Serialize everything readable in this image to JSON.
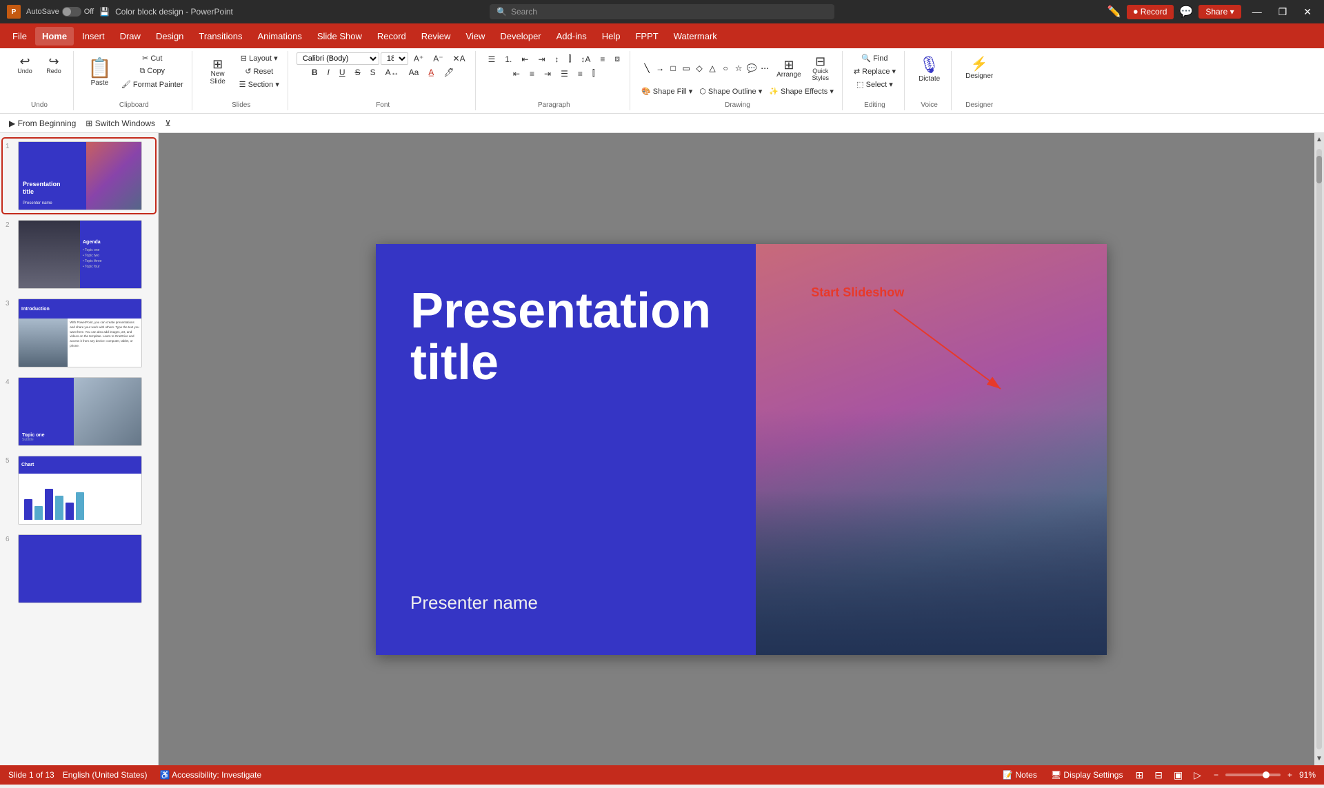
{
  "titleBar": {
    "appName": "PowerPoint",
    "fileName": "Color block design - PowerPoint",
    "autoSave": "AutoSave",
    "autoSaveState": "Off",
    "recordLabel": "Record",
    "shareLabel": "Share",
    "searchPlaceholder": "Search",
    "windowControls": [
      "—",
      "❐",
      "✕"
    ]
  },
  "menuBar": {
    "items": [
      "File",
      "Home",
      "Insert",
      "Draw",
      "Design",
      "Transitions",
      "Animations",
      "Slide Show",
      "Record",
      "Review",
      "View",
      "Developer",
      "Add-ins",
      "Help",
      "FPPT",
      "Watermark"
    ],
    "activeItem": "Home"
  },
  "ribbon": {
    "groups": [
      {
        "name": "undo-group",
        "label": "Undo",
        "buttons": [
          "↩ Undo",
          "↪ Redo"
        ]
      },
      {
        "name": "clipboard-group",
        "label": "Clipboard",
        "buttons": [
          "Paste",
          "Cut",
          "Copy",
          "Format Painter"
        ]
      },
      {
        "name": "slides-group",
        "label": "Slides",
        "buttons": [
          "New Slide",
          "Layout",
          "Reset",
          "Section"
        ]
      },
      {
        "name": "font-group",
        "label": "Font",
        "buttons": [
          "Bold",
          "Italic",
          "Underline",
          "Strikethrough",
          "Shadow"
        ]
      },
      {
        "name": "paragraph-group",
        "label": "Paragraph",
        "buttons": [
          "Bullets",
          "Numbering",
          "Increase Indent",
          "Decrease Indent",
          "Align Left",
          "Center",
          "Align Right",
          "Justify"
        ]
      },
      {
        "name": "drawing-group",
        "label": "Drawing",
        "buttons": [
          "Arrange",
          "Quick Styles",
          "Shape Fill",
          "Shape Outline",
          "Shape Effects"
        ]
      },
      {
        "name": "editing-group",
        "label": "Editing",
        "buttons": [
          "Find",
          "Replace",
          "Select"
        ]
      },
      {
        "name": "voice-group",
        "label": "Voice",
        "buttons": [
          "Dictate"
        ]
      },
      {
        "name": "designer-group",
        "label": "Designer",
        "buttons": [
          "Designer"
        ]
      }
    ]
  },
  "quickAccess": {
    "buttons": [
      "From Beginning",
      "Switch Windows",
      "⊻"
    ]
  },
  "slides": [
    {
      "num": "1",
      "title": "Presentation title",
      "presenter": "Presenter name",
      "type": "title-slide",
      "active": true
    },
    {
      "num": "2",
      "title": "Agenda",
      "type": "agenda-slide",
      "active": false
    },
    {
      "num": "3",
      "title": "Introduction",
      "type": "intro-slide",
      "active": false
    },
    {
      "num": "4",
      "title": "Topic one",
      "subtitle": "Subtitle",
      "type": "topic-slide",
      "active": false
    },
    {
      "num": "5",
      "title": "Chart",
      "type": "chart-slide",
      "active": false
    },
    {
      "num": "6",
      "title": "",
      "type": "section-slide",
      "active": false
    }
  ],
  "canvas": {
    "presentationTitle": "Presentation title",
    "presenterName": "Presenter name",
    "startSlideshowLabel": "Start Slideshow"
  },
  "statusBar": {
    "slideInfo": "Slide 1 of 13",
    "language": "English (United States)",
    "accessibility": "Accessibility: Investigate",
    "notes": "Notes",
    "displaySettings": "Display Settings",
    "zoom": "91%",
    "views": [
      "Normal",
      "Slide Sorter",
      "Reading View",
      "Slide Show"
    ]
  }
}
